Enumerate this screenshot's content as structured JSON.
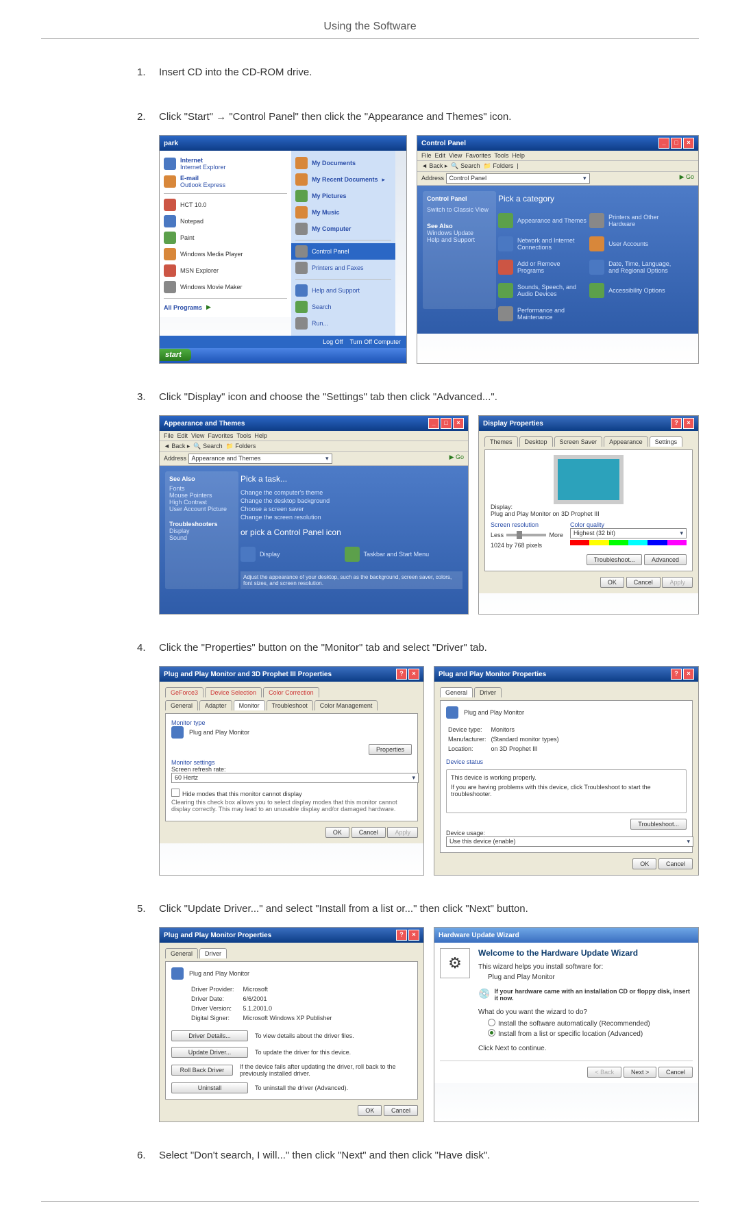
{
  "header": {
    "title": "Using the Software"
  },
  "steps": [
    {
      "num": "1.",
      "text": "Insert CD into the CD-ROM drive."
    },
    {
      "num": "2.",
      "text": "Click \"Start\" → \"Control Panel\" then click the \"Appearance and Themes\" icon."
    },
    {
      "num": "3.",
      "text": "Click \"Display\" icon and choose the \"Settings\" tab then click \"Advanced...\"."
    },
    {
      "num": "4.",
      "text": "Click the \"Properties\" button on the \"Monitor\" tab and select \"Driver\" tab."
    },
    {
      "num": "5.",
      "text": "Click \"Update Driver...\" and select \"Install from a list or...\" then click \"Next\" button."
    },
    {
      "num": "6.",
      "text": "Select \"Don't search, I will...\" then click \"Next\" and then click \"Have disk\"."
    }
  ],
  "start_menu": {
    "user": "park",
    "left": [
      {
        "l1": "Internet",
        "l2": "Internet Explorer"
      },
      {
        "l1": "E-mail",
        "l2": "Outlook Express"
      },
      {
        "l1": "HCT 10.0",
        "l2": ""
      },
      {
        "l1": "Notepad",
        "l2": ""
      },
      {
        "l1": "Paint",
        "l2": ""
      },
      {
        "l1": "Windows Media Player",
        "l2": ""
      },
      {
        "l1": "MSN Explorer",
        "l2": ""
      },
      {
        "l1": "Windows Movie Maker",
        "l2": ""
      }
    ],
    "all_programs": "All Programs",
    "right": [
      "My Documents",
      "My Recent Documents",
      "My Pictures",
      "My Music",
      "My Computer",
      "Control Panel",
      "Printers and Faxes",
      "Help and Support",
      "Search",
      "Run..."
    ],
    "right_highlight_index": 5,
    "logoff": "Log Off",
    "turnoff": "Turn Off Computer",
    "start": "start"
  },
  "control_panel": {
    "title": "Control Panel",
    "address": "Control Panel",
    "heading": "Pick a category",
    "left_title": "Control Panel",
    "left_items": [
      "Switch to Classic View"
    ],
    "see_also_title": "See Also",
    "see_also": [
      "Windows Update",
      "Help and Support"
    ],
    "cats": [
      "Appearance and Themes",
      "Printers and Other Hardware",
      "Network and Internet Connections",
      "User Accounts",
      "Add or Remove Programs",
      "Date, Time, Language, and Regional Options",
      "Sounds, Speech, and Audio Devices",
      "Accessibility Options",
      "Performance and Maintenance"
    ]
  },
  "appearance_themes": {
    "title": "Appearance and Themes",
    "heading_task": "Pick a task...",
    "tasks": [
      "Change the computer's theme",
      "Change the desktop background",
      "Choose a screen saver",
      "Change the screen resolution"
    ],
    "heading_cp": "or pick a Control Panel icon",
    "icons": [
      "Display",
      "Taskbar and Start Menu"
    ],
    "also": "Adjust the appearance of your desktop, such as the background, screen saver, colors, font sizes, and screen resolution."
  },
  "display_props": {
    "title": "Display Properties",
    "tabs": [
      "Themes",
      "Desktop",
      "Screen Saver",
      "Appearance",
      "Settings"
    ],
    "display_label": "Display:",
    "display_value": "Plug and Play Monitor on 3D Prophet III",
    "res_label": "Screen resolution",
    "res_less": "Less",
    "res_more": "More",
    "res_value": "1024 by 768 pixels",
    "color_label": "Color quality",
    "color_value": "Highest (32 bit)",
    "troubleshoot": "Troubleshoot...",
    "advanced": "Advanced",
    "ok": "OK",
    "cancel": "Cancel",
    "apply": "Apply"
  },
  "monitor_adv": {
    "title": "Plug and Play Monitor and 3D Prophet III Properties",
    "tabs_row1": [
      "GeForce3",
      "Device Selection",
      "Color Correction"
    ],
    "tabs_row2": [
      "General",
      "Adapter",
      "Monitor",
      "Troubleshoot",
      "Color Management"
    ],
    "mtype_label": "Monitor type",
    "mtype_value": "Plug and Play Monitor",
    "properties": "Properties",
    "msettings_label": "Monitor settings",
    "refresh_label": "Screen refresh rate:",
    "refresh_value": "60 Hertz",
    "hide_cb": "Hide modes that this monitor cannot display",
    "hide_note": "Clearing this check box allows you to select display modes that this monitor cannot display correctly. This may lead to an unusable display and/or damaged hardware.",
    "ok": "OK",
    "cancel": "Cancel",
    "apply": "Apply"
  },
  "monitor_props": {
    "title": "Plug and Play Monitor Properties",
    "tabs": [
      "General",
      "Driver"
    ],
    "name": "Plug and Play Monitor",
    "dt_label": "Device type:",
    "dt_value": "Monitors",
    "mf_label": "Manufacturer:",
    "mf_value": "(Standard monitor types)",
    "loc_label": "Location:",
    "loc_value": "on 3D Prophet III",
    "status_label": "Device status",
    "status_text": "This device is working properly.",
    "status_hint": "If you are having problems with this device, click Troubleshoot to start the troubleshooter.",
    "troubleshoot": "Troubleshoot...",
    "usage_label": "Device usage:",
    "usage_value": "Use this device (enable)",
    "ok": "OK",
    "cancel": "Cancel"
  },
  "monitor_driver": {
    "title": "Plug and Play Monitor Properties",
    "tabs": [
      "General",
      "Driver"
    ],
    "name": "Plug and Play Monitor",
    "provider_l": "Driver Provider:",
    "provider_v": "Microsoft",
    "date_l": "Driver Date:",
    "date_v": "6/6/2001",
    "ver_l": "Driver Version:",
    "ver_v": "5.1.2001.0",
    "signer_l": "Digital Signer:",
    "signer_v": "Microsoft Windows XP Publisher",
    "details_btn": "Driver Details...",
    "details_txt": "To view details about the driver files.",
    "update_btn": "Update Driver...",
    "update_txt": "To update the driver for this device.",
    "rollback_btn": "Roll Back Driver",
    "rollback_txt": "If the device fails after updating the driver, roll back to the previously installed driver.",
    "uninstall_btn": "Uninstall",
    "uninstall_txt": "To uninstall the driver (Advanced).",
    "ok": "OK",
    "cancel": "Cancel"
  },
  "wizard": {
    "title": "Hardware Update Wizard",
    "welcome": "Welcome to the Hardware Update Wizard",
    "intro": "This wizard helps you install software for:",
    "device": "Plug and Play Monitor",
    "cd_hint": "If your hardware came with an installation CD or floppy disk, insert it now.",
    "q": "What do you want the wizard to do?",
    "opt1": "Install the software automatically (Recommended)",
    "opt2": "Install from a list or specific location (Advanced)",
    "cont": "Click Next to continue.",
    "back": "< Back",
    "next": "Next >",
    "cancel": "Cancel"
  }
}
